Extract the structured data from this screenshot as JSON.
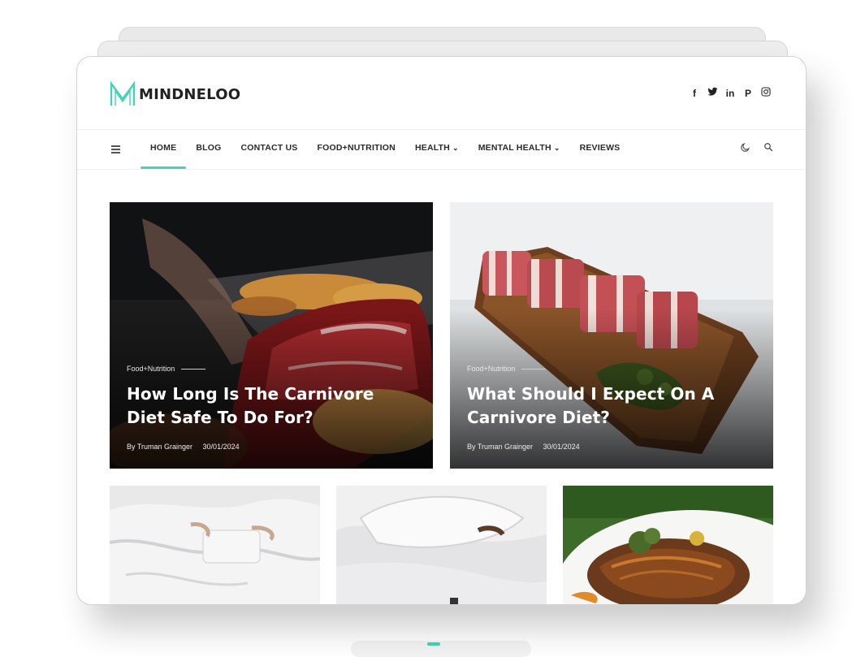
{
  "site": {
    "name": "MINDNELOO"
  },
  "social": [
    {
      "icon": "facebook-icon",
      "glyph": "f"
    },
    {
      "icon": "twitter-icon",
      "glyph": "t"
    },
    {
      "icon": "linkedin-icon",
      "glyph": "in"
    },
    {
      "icon": "pinterest-icon",
      "glyph": "P"
    },
    {
      "icon": "instagram-icon",
      "glyph": "◎"
    }
  ],
  "nav": {
    "items": [
      {
        "label": "HOME",
        "active": true,
        "dropdown": false
      },
      {
        "label": "BLOG",
        "active": false,
        "dropdown": false
      },
      {
        "label": "CONTACT US",
        "active": false,
        "dropdown": false
      },
      {
        "label": "FOOD+NUTRITION",
        "active": false,
        "dropdown": false
      },
      {
        "label": "HEALTH",
        "active": false,
        "dropdown": true
      },
      {
        "label": "MENTAL HEALTH",
        "active": false,
        "dropdown": true
      },
      {
        "label": "REVIEWS",
        "active": false,
        "dropdown": false
      }
    ],
    "chevron": "⌄",
    "menu_icon": "hamburger-icon",
    "theme_icon": "moon-icon",
    "search_icon": "search-icon",
    "theme_glyph": "☾",
    "search_glyph": "⚲"
  },
  "featured": [
    {
      "category": "Food+Nutrition",
      "title": "How Long Is The Carnivore Diet Safe To Do For?",
      "author": "By Truman Grainger",
      "date": "30/01/2024"
    },
    {
      "category": "Food+Nutrition",
      "title": "What Should I Expect On A Carnivore Diet?",
      "author": "By Truman Grainger",
      "date": "30/01/2024"
    }
  ],
  "colors": {
    "accent": "#43d3b5",
    "text": "#222222"
  }
}
